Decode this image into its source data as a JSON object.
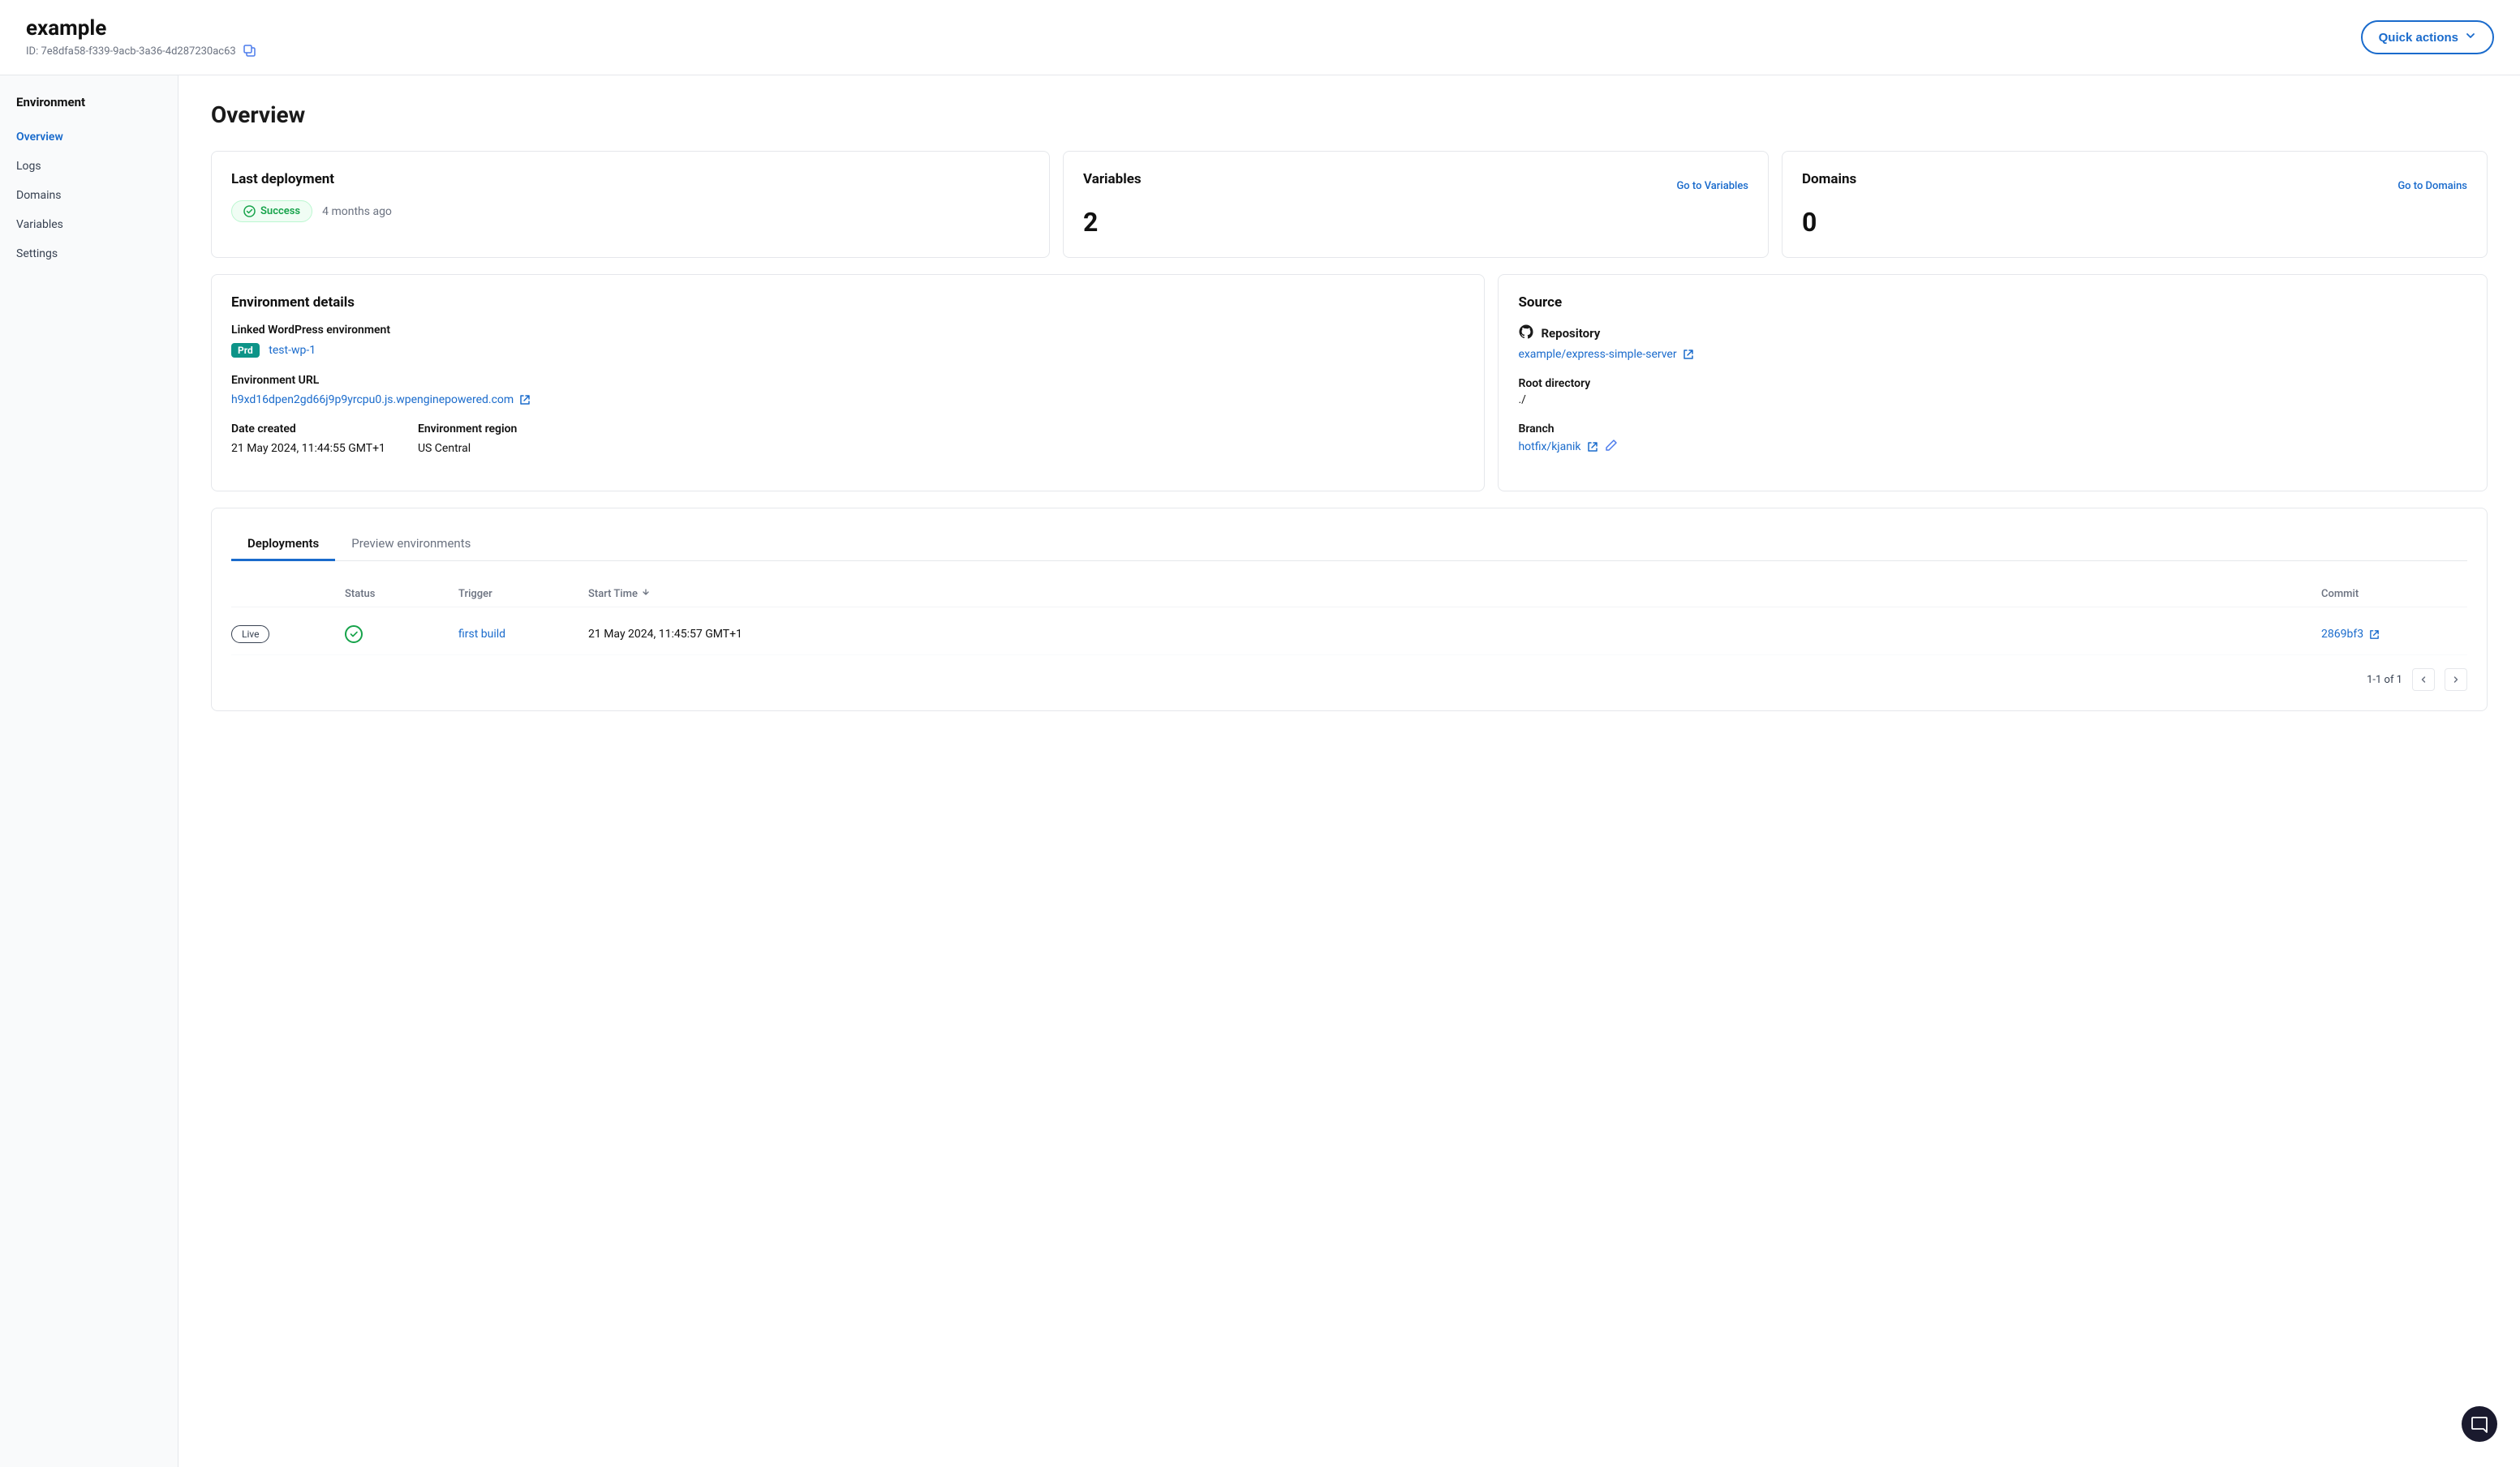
{
  "header": {
    "app_name": "example",
    "app_id_label": "ID: 7e8dfa58-f339-9acb-3a36-4d287230ac63",
    "quick_actions_label": "Quick actions"
  },
  "sidebar": {
    "title": "Environment",
    "items": [
      {
        "label": "Overview",
        "active": true
      },
      {
        "label": "Logs",
        "active": false
      },
      {
        "label": "Domains",
        "active": false
      },
      {
        "label": "Variables",
        "active": false
      },
      {
        "label": "Settings",
        "active": false
      }
    ]
  },
  "main": {
    "page_title": "Overview",
    "last_deployment": {
      "title": "Last deployment",
      "status": "Success",
      "time_ago": "4 months ago"
    },
    "variables": {
      "title": "Variables",
      "link_label": "Go to Variables",
      "count": "2"
    },
    "domains": {
      "title": "Domains",
      "link_label": "Go to Domains",
      "count": "0"
    },
    "env_details": {
      "title": "Environment details",
      "linked_wp_label": "Linked WordPress environment",
      "prd_badge": "Prd",
      "wp_env_link": "test-wp-1",
      "env_url_label": "Environment URL",
      "env_url": "h9xd16dpen2gd66j9p9yrcpu0.js.wpenginepowered.com",
      "date_created_label": "Date created",
      "date_created_value": "21 May 2024, 11:44:55 GMT+1",
      "env_region_label": "Environment region",
      "env_region_value": "US Central"
    },
    "source": {
      "title": "Source",
      "repo_label": "Repository",
      "repo_link": "example/express-simple-server",
      "root_dir_label": "Root directory",
      "root_dir_value": "./",
      "branch_label": "Branch",
      "branch_link": "hotfix/kjanik"
    },
    "deployments_tab": {
      "tab1": "Deployments",
      "tab2": "Preview environments",
      "table_headers": {
        "status": "Status",
        "trigger": "Trigger",
        "start_time": "Start Time",
        "commit": "Commit"
      },
      "rows": [
        {
          "live_badge": "Live",
          "status_icon": "success",
          "trigger": "first build",
          "start_time": "21 May 2024, 11:45:57 GMT+1",
          "commit": "2869bf3"
        }
      ],
      "pagination": "1-1 of 1"
    }
  }
}
